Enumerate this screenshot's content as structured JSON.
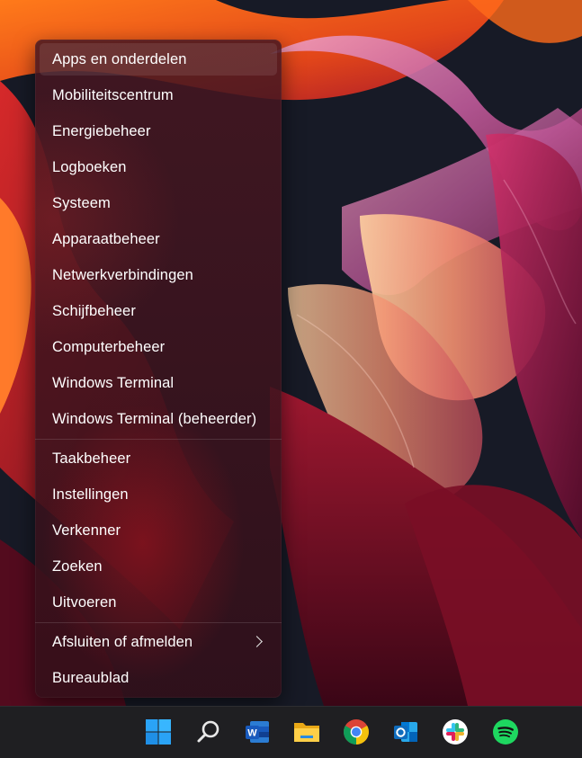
{
  "context_menu": {
    "items": [
      {
        "label": "Apps en onderdelen"
      },
      {
        "label": "Mobiliteitscentrum"
      },
      {
        "label": "Energiebeheer"
      },
      {
        "label": "Logboeken"
      },
      {
        "label": "Systeem"
      },
      {
        "label": "Apparaatbeheer"
      },
      {
        "label": "Netwerkverbindingen"
      },
      {
        "label": "Schijfbeheer"
      },
      {
        "label": "Computerbeheer"
      },
      {
        "label": "Windows Terminal"
      },
      {
        "label": "Windows Terminal (beheerder)"
      },
      {
        "label": "Taakbeheer"
      },
      {
        "label": "Instellingen"
      },
      {
        "label": "Verkenner"
      },
      {
        "label": "Zoeken"
      },
      {
        "label": "Uitvoeren"
      },
      {
        "label": "Afsluiten of afmelden"
      },
      {
        "label": "Bureaublad"
      }
    ]
  },
  "taskbar": {
    "icons": [
      "windows-start-icon",
      "search-icon",
      "word-icon",
      "file-explorer-icon",
      "chrome-icon",
      "outlook-icon",
      "slack-icon",
      "spotify-icon"
    ]
  },
  "colors": {
    "menu_text": "#ffffff",
    "taskbar_bg": "#1f1f22",
    "windows_blue": "#2a9df4",
    "word_blue": "#185abd",
    "outlook_blue": "#0f6cbd",
    "spotify_green": "#1ed760",
    "folder_yellow": "#f4c430"
  }
}
